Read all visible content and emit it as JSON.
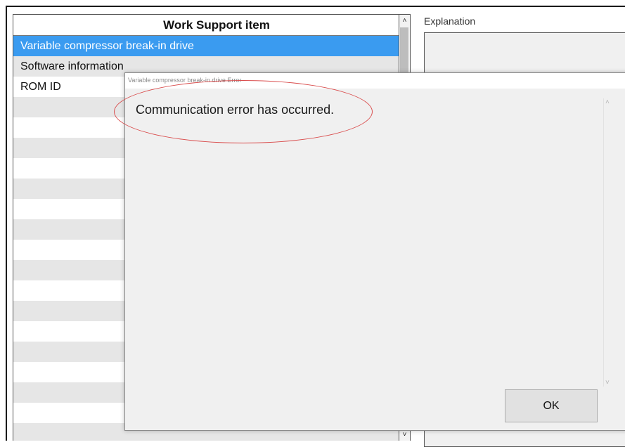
{
  "work_support": {
    "header": "Work Support item",
    "items": [
      {
        "label": "Variable compressor break-in drive",
        "selected": true
      },
      {
        "label": "Software information",
        "selected": false
      },
      {
        "label": "ROM ID",
        "selected": false
      }
    ],
    "empty_rows": 18
  },
  "explanation": {
    "label": "Explanation"
  },
  "dialog": {
    "title": "Variable compressor break-in drive Error",
    "message": "Communication error has occurred.",
    "ok_label": "OK"
  },
  "scroll": {
    "up_icon": "▲",
    "down_icon": "▼"
  },
  "colors": {
    "selection": "#3a9bf0",
    "annotation": "#d94b4b",
    "dialog_bg": "#f0f0f0"
  }
}
